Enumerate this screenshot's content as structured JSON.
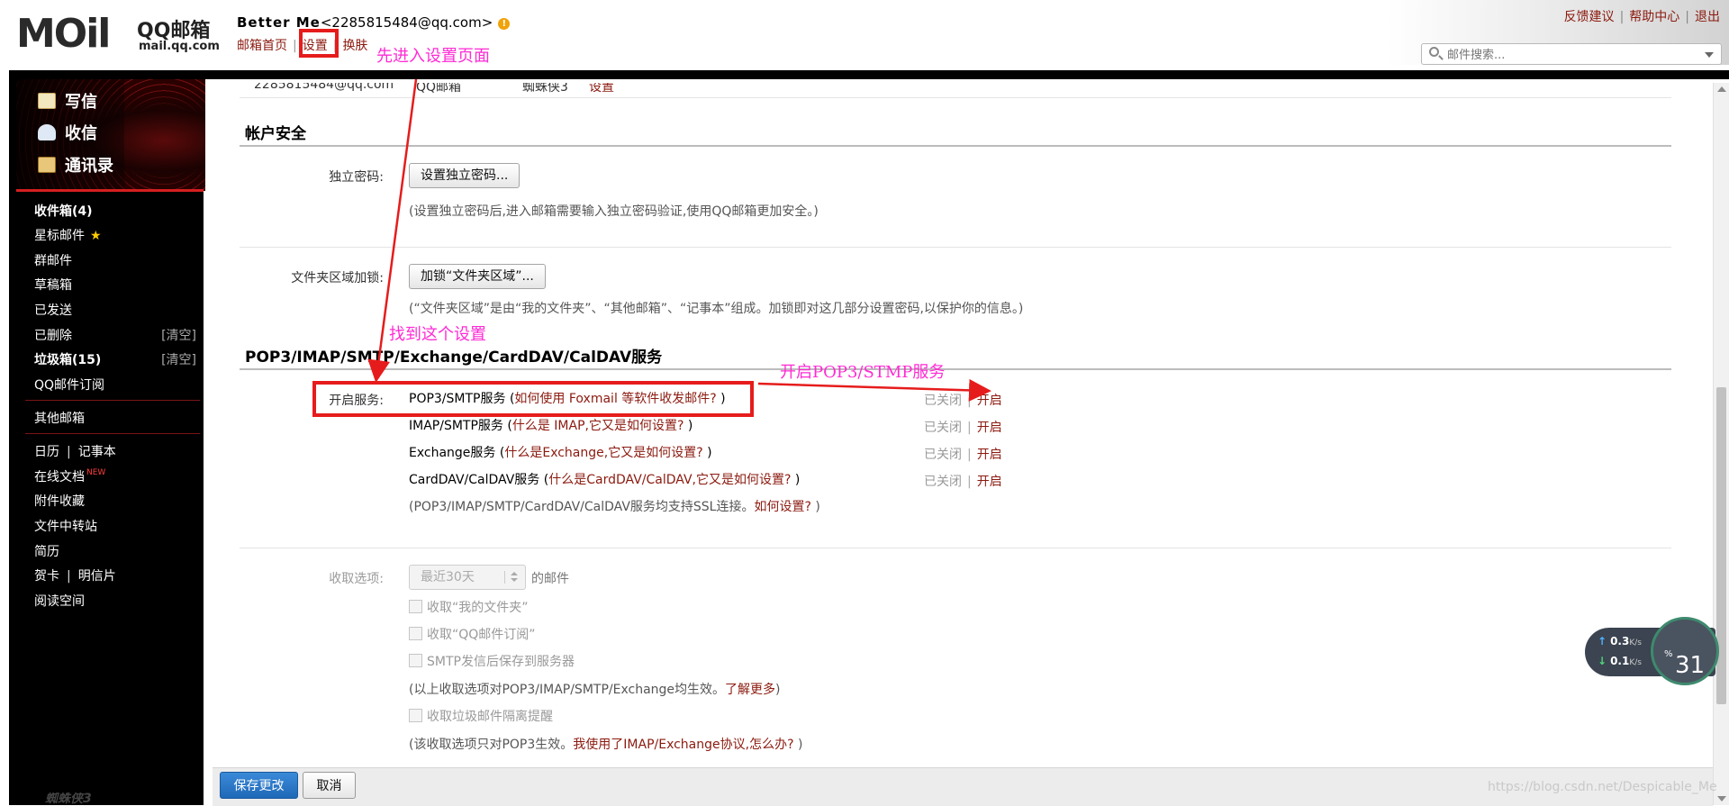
{
  "logo": {
    "mark": "MOil",
    "name": "QQ邮箱",
    "url": "mail.qq.com"
  },
  "user": {
    "name": "Better  Me",
    "email": "<2285815484@qq.com>",
    "warn_icon": "!"
  },
  "top_nav": {
    "home": "邮箱首页",
    "settings": "设置",
    "skin": "换肤",
    "sep": "|"
  },
  "top_links": {
    "feedback": "反馈建议",
    "help": "帮助中心",
    "logout": "退出",
    "sep": "|"
  },
  "search": {
    "placeholder": "邮件搜索..."
  },
  "sidebar": {
    "compose": "写信",
    "receive": "收信",
    "contacts": "通讯录",
    "inbox": "收件箱(4)",
    "starred": "星标邮件",
    "starred_icon": "★",
    "group": "群邮件",
    "drafts": "草稿箱",
    "sent": "已发送",
    "deleted": "已删除",
    "deleted_clear": "[清空]",
    "spam": "垃圾箱(15)",
    "spam_clear": "[清空]",
    "subscribe": "QQ邮件订阅",
    "other_mail": "其他邮箱",
    "calendar": "日历",
    "notes": "记事本",
    "docs": "在线文档",
    "docs_badge": "NEW",
    "attachments": "附件收藏",
    "transfer": "文件中转站",
    "resume": "简历",
    "cards": "贺卡",
    "postcards": "明信片",
    "reading": "阅读空间",
    "bottom_text": "蜘蛛侠3",
    "pipe": "|"
  },
  "account_row": {
    "email": "2285815484@qq.com",
    "type": "QQ邮箱",
    "skin": "蜘蛛侠3",
    "action": "设置"
  },
  "security": {
    "title": "帐户安全",
    "password_label": "独立密码:",
    "password_button": "设置独立密码...",
    "password_hint": "(设置独立密码后,进入邮箱需要输入独立密码验证,使用QQ邮箱更加安全。)",
    "folder_label": "文件夹区域加锁:",
    "folder_button": "加锁“文件夹区域”...",
    "folder_hint": "(“文件夹区域”是由“我的文件夹”、“其他邮箱”、“记事本”组成。加锁即对这几部分设置密码,以保护你的信息。)"
  },
  "services": {
    "title": "POP3/IMAP/SMTP/Exchange/CardDAV/CalDAV服务",
    "label": "开启服务:",
    "items": [
      {
        "name": "POP3/SMTP服务",
        "open": " (",
        "link": "如何使用 Foxmail 等软件收发邮件?",
        "close": " )",
        "state": "已关闭",
        "action": "开启"
      },
      {
        "name": "IMAP/SMTP服务",
        "open": " (",
        "link": "什么是 IMAP,它又是如何设置?",
        "close": " )",
        "state": "已关闭",
        "action": "开启"
      },
      {
        "name": "Exchange服务",
        "open": " (",
        "link": "什么是Exchange,它又是如何设置?",
        "close": " )",
        "state": "已关闭",
        "action": "开启"
      },
      {
        "name": "CardDAV/CalDAV服务",
        "open": " (",
        "link": "什么是CardDAV/CalDAV,它又是如何设置?",
        "close": " )",
        "state": "已关闭",
        "action": "开启"
      }
    ],
    "ssl_note": "(POP3/IMAP/SMTP/CardDAV/CalDAV服务均支持SSL连接。",
    "ssl_link": "如何设置?",
    "ssl_close": " )"
  },
  "receive_options": {
    "label": "收取选项:",
    "range_value": "最近30天",
    "range_suffix": "的邮件",
    "opt_folders": "收取“我的文件夹”",
    "opt_subscribe": "收取“QQ邮件订阅”",
    "opt_smtp_save": "SMTP发信后保存到服务器",
    "note1": "(以上收取选项对POP3/IMAP/SMTP/Exchange均生效。",
    "note1_link": "了解更多",
    "note1_close": ")",
    "opt_spam": "收取垃圾邮件隔离提醒",
    "note2": "(该收取选项只对POP3生效。",
    "note2_link": "我使用了IMAP/Exchange协议,怎么办?",
    "note2_close": " )"
  },
  "actions": {
    "save": "保存更改",
    "cancel": "取消"
  },
  "annotations": {
    "step1": "先进入设置页面",
    "step2": "找到这个设置",
    "step3": "开启POP3/STMP服务"
  },
  "net_widget": {
    "up": "0.3",
    "down": "0.1",
    "unit": "K/s",
    "percent": "31",
    "percent_unit": "%",
    "up_icon": "↑",
    "down_icon": "↓"
  },
  "watermark": "https://blog.csdn.net/Despicable_Me",
  "colors": {
    "link": "#8b1a0f",
    "annotation_box": "#e61c1c",
    "annotation_text": "#ff2ad4",
    "save_button": "#2a78c8"
  }
}
